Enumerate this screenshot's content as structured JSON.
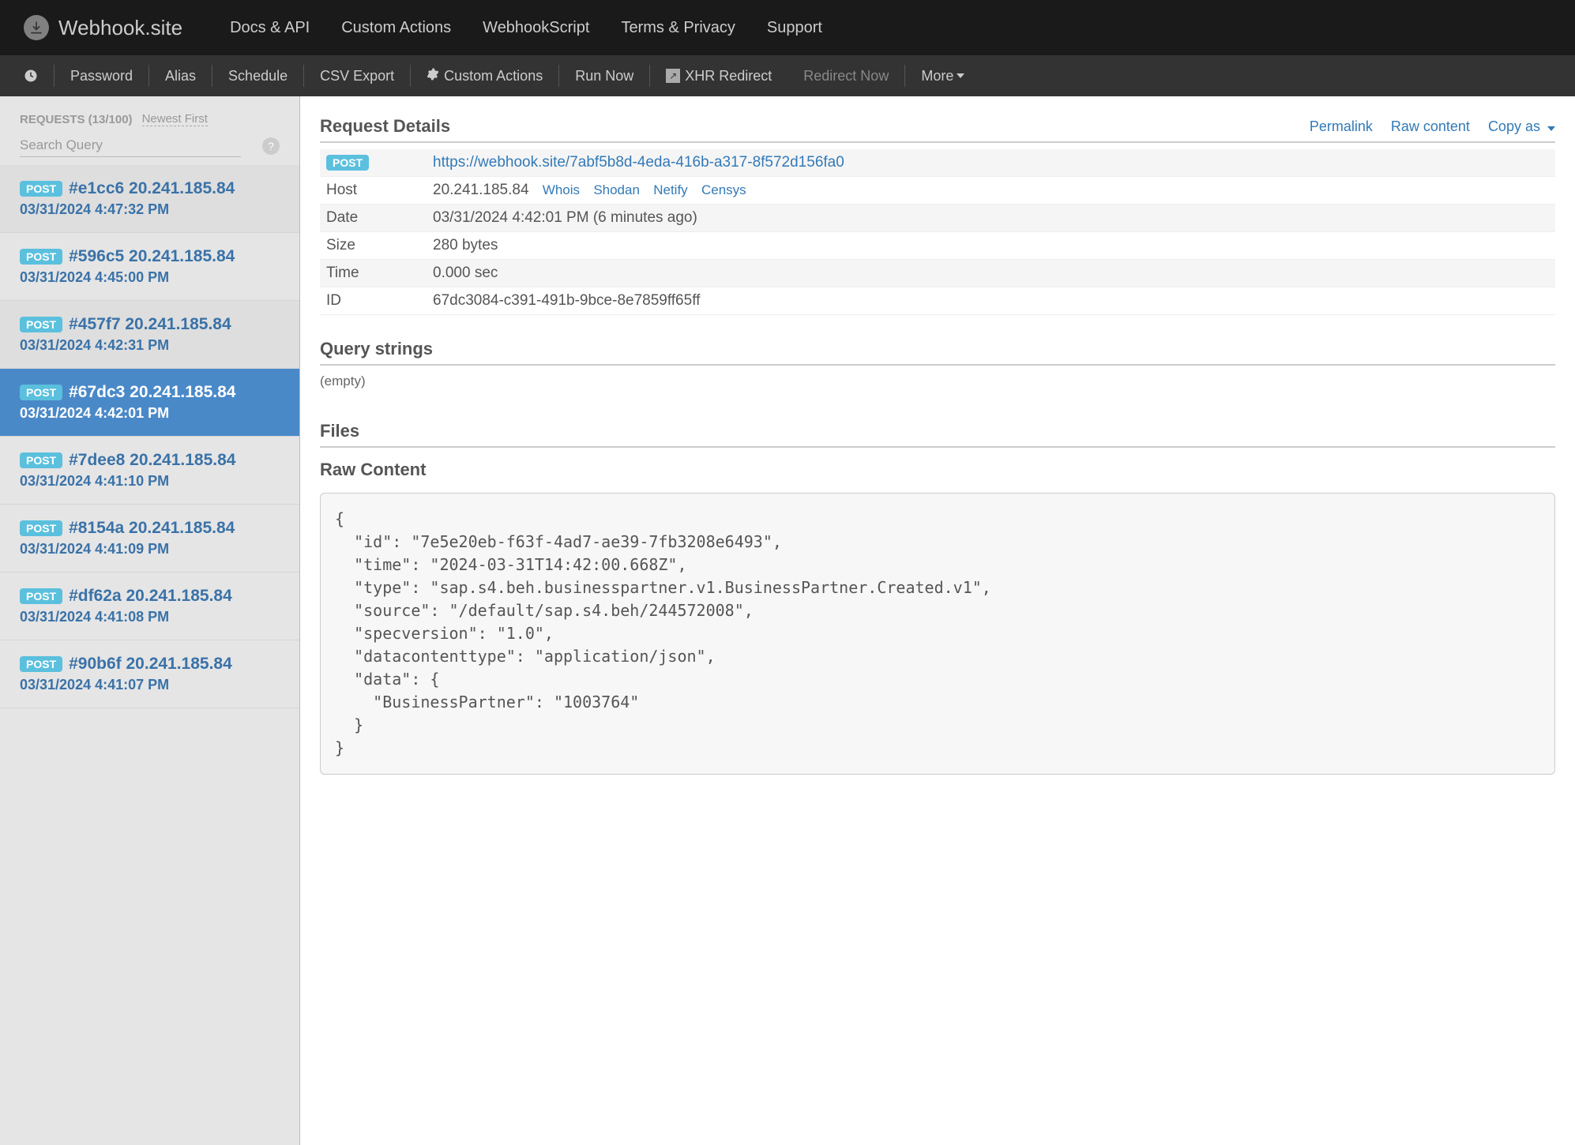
{
  "brand": "Webhook.site",
  "topnav": {
    "items": [
      "Docs & API",
      "Custom Actions",
      "WebhookScript",
      "Terms & Privacy",
      "Support"
    ]
  },
  "subnav": {
    "password": "Password",
    "alias": "Alias",
    "schedule": "Schedule",
    "csv": "CSV Export",
    "custom_actions": "Custom Actions",
    "run_now": "Run Now",
    "xhr_redirect": "XHR Redirect",
    "redirect_now": "Redirect Now",
    "more": "More"
  },
  "sidebar": {
    "header": "REQUESTS (13/100)",
    "sort_label": "Newest First",
    "search_placeholder": "Search Query",
    "items": [
      {
        "method": "POST",
        "hash": "#e1cc6",
        "ip": "20.241.185.84",
        "date": "03/31/2024 4:47:32 PM",
        "selected": false,
        "shade": "dark"
      },
      {
        "method": "POST",
        "hash": "#596c5",
        "ip": "20.241.185.84",
        "date": "03/31/2024 4:45:00 PM",
        "selected": false,
        "shade": "light"
      },
      {
        "method": "POST",
        "hash": "#457f7",
        "ip": "20.241.185.84",
        "date": "03/31/2024 4:42:31 PM",
        "selected": false,
        "shade": "dark"
      },
      {
        "method": "POST",
        "hash": "#67dc3",
        "ip": "20.241.185.84",
        "date": "03/31/2024 4:42:01 PM",
        "selected": true,
        "shade": "sel"
      },
      {
        "method": "POST",
        "hash": "#7dee8",
        "ip": "20.241.185.84",
        "date": "03/31/2024 4:41:10 PM",
        "selected": false,
        "shade": "light"
      },
      {
        "method": "POST",
        "hash": "#8154a",
        "ip": "20.241.185.84",
        "date": "03/31/2024 4:41:09 PM",
        "selected": false,
        "shade": "light"
      },
      {
        "method": "POST",
        "hash": "#df62a",
        "ip": "20.241.185.84",
        "date": "03/31/2024 4:41:08 PM",
        "selected": false,
        "shade": "light"
      },
      {
        "method": "POST",
        "hash": "#90b6f",
        "ip": "20.241.185.84",
        "date": "03/31/2024 4:41:07 PM",
        "selected": false,
        "shade": "light"
      }
    ]
  },
  "details": {
    "heading": "Request Details",
    "permalink": "Permalink",
    "raw_content": "Raw content",
    "copy_as": "Copy as",
    "method": "POST",
    "url": "https://webhook.site/7abf5b8d-4eda-416b-a317-8f572d156fa0",
    "rows": {
      "host_label": "Host",
      "host_value": "20.241.185.84",
      "date_label": "Date",
      "date_value": "03/31/2024 4:42:01 PM (6 minutes ago)",
      "size_label": "Size",
      "size_value": "280 bytes",
      "time_label": "Time",
      "time_value": "0.000 sec",
      "id_label": "ID",
      "id_value": "67dc3084-c391-491b-9bce-8e7859ff65ff"
    },
    "tools": {
      "whois": "Whois",
      "shodan": "Shodan",
      "netify": "Netify",
      "censys": "Censys"
    }
  },
  "query": {
    "heading": "Query strings",
    "empty": "(empty)"
  },
  "files": {
    "heading": "Files"
  },
  "raw": {
    "heading": "Raw Content",
    "body": "{\n  \"id\": \"7e5e20eb-f63f-4ad7-ae39-7fb3208e6493\",\n  \"time\": \"2024-03-31T14:42:00.668Z\",\n  \"type\": \"sap.s4.beh.businesspartner.v1.BusinessPartner.Created.v1\",\n  \"source\": \"/default/sap.s4.beh/244572008\",\n  \"specversion\": \"1.0\",\n  \"datacontenttype\": \"application/json\",\n  \"data\": {\n    \"BusinessPartner\": \"1003764\"\n  }\n}"
  }
}
